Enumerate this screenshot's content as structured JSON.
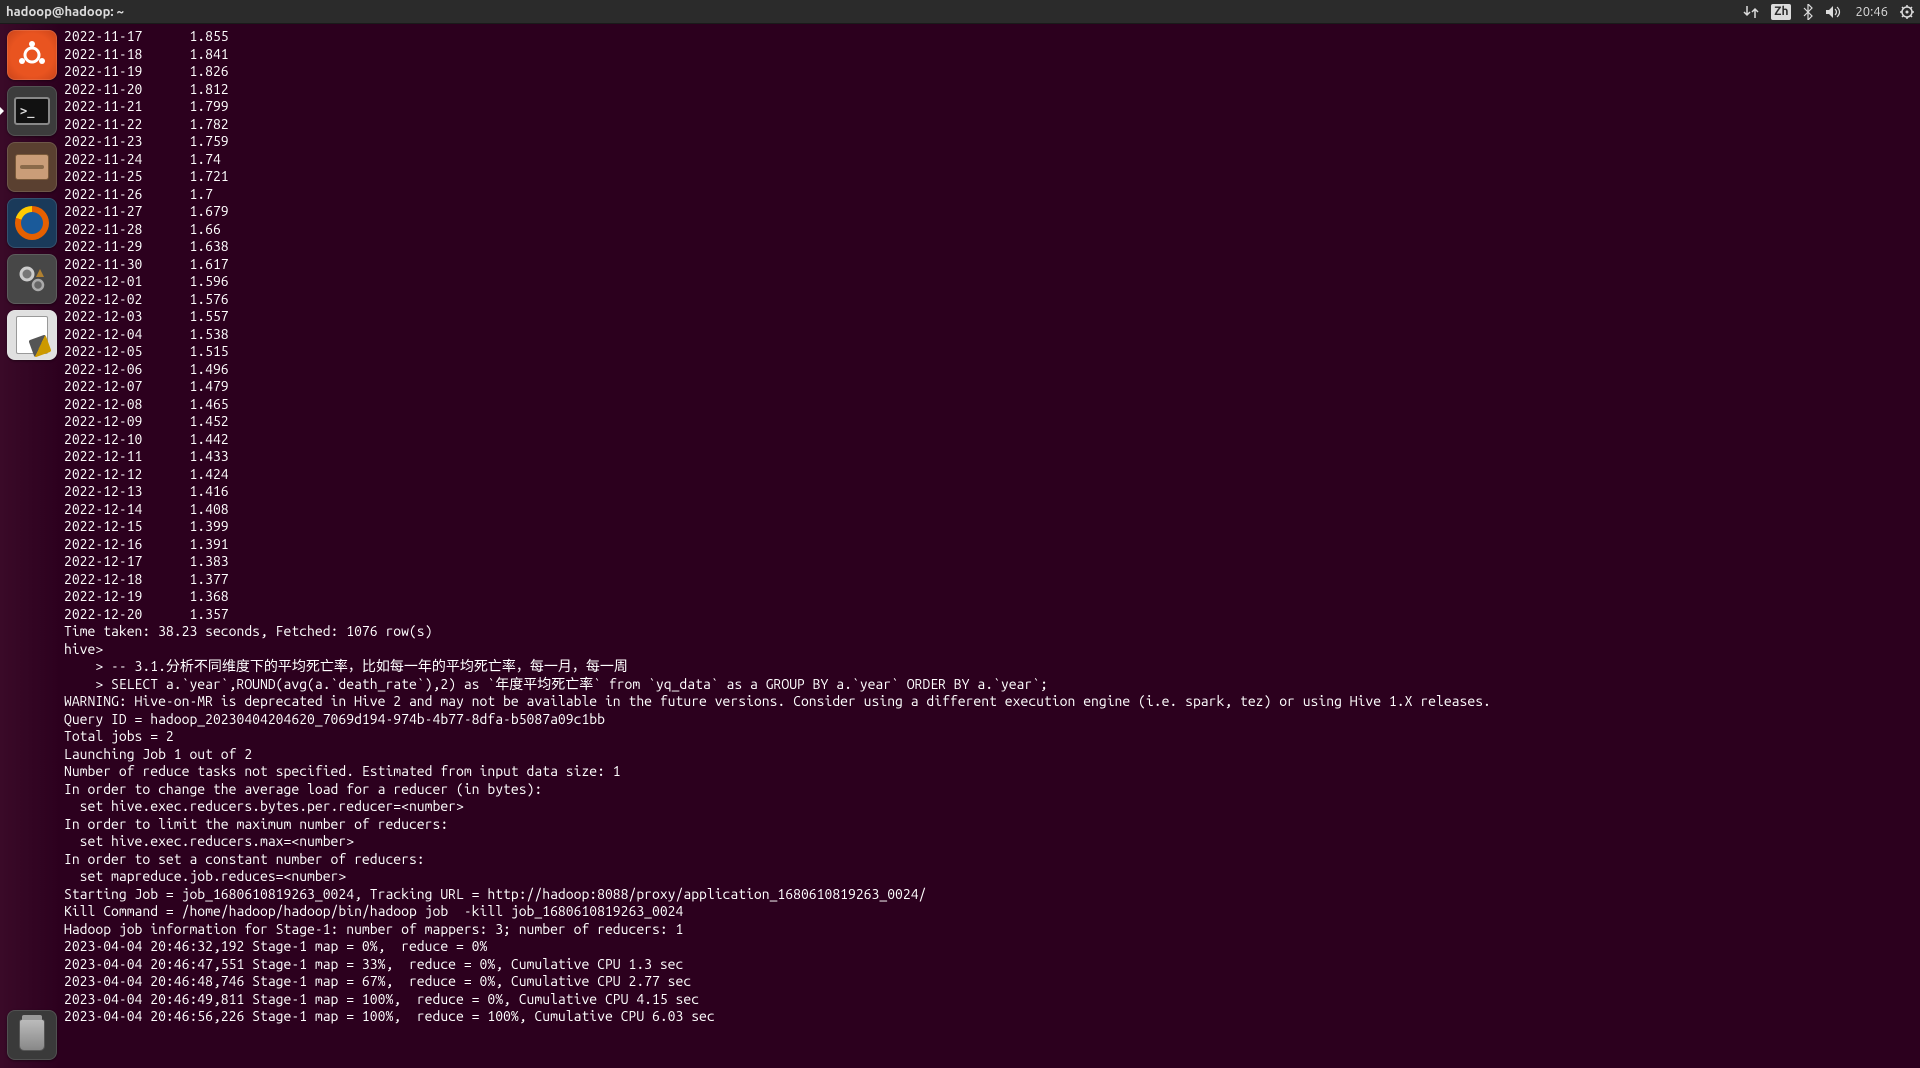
{
  "top_panel": {
    "title": "hadoop@hadoop: ~",
    "input_method": "Zh",
    "time": "20:46"
  },
  "launcher": {
    "items": [
      {
        "name": "ubuntu-dash",
        "label": "Ubuntu"
      },
      {
        "name": "terminal",
        "label": "Terminal",
        "active": true
      },
      {
        "name": "files",
        "label": "Files"
      },
      {
        "name": "firefox",
        "label": "Firefox"
      },
      {
        "name": "settings",
        "label": "Settings"
      },
      {
        "name": "text-editor",
        "label": "Text Editor"
      }
    ],
    "trash": "Trash"
  },
  "terminal": {
    "data_rows": [
      {
        "date": "2022-11-17",
        "val": "1.855"
      },
      {
        "date": "2022-11-18",
        "val": "1.841"
      },
      {
        "date": "2022-11-19",
        "val": "1.826"
      },
      {
        "date": "2022-11-20",
        "val": "1.812"
      },
      {
        "date": "2022-11-21",
        "val": "1.799"
      },
      {
        "date": "2022-11-22",
        "val": "1.782"
      },
      {
        "date": "2022-11-23",
        "val": "1.759"
      },
      {
        "date": "2022-11-24",
        "val": "1.74"
      },
      {
        "date": "2022-11-25",
        "val": "1.721"
      },
      {
        "date": "2022-11-26",
        "val": "1.7"
      },
      {
        "date": "2022-11-27",
        "val": "1.679"
      },
      {
        "date": "2022-11-28",
        "val": "1.66"
      },
      {
        "date": "2022-11-29",
        "val": "1.638"
      },
      {
        "date": "2022-11-30",
        "val": "1.617"
      },
      {
        "date": "2022-12-01",
        "val": "1.596"
      },
      {
        "date": "2022-12-02",
        "val": "1.576"
      },
      {
        "date": "2022-12-03",
        "val": "1.557"
      },
      {
        "date": "2022-12-04",
        "val": "1.538"
      },
      {
        "date": "2022-12-05",
        "val": "1.515"
      },
      {
        "date": "2022-12-06",
        "val": "1.496"
      },
      {
        "date": "2022-12-07",
        "val": "1.479"
      },
      {
        "date": "2022-12-08",
        "val": "1.465"
      },
      {
        "date": "2022-12-09",
        "val": "1.452"
      },
      {
        "date": "2022-12-10",
        "val": "1.442"
      },
      {
        "date": "2022-12-11",
        "val": "1.433"
      },
      {
        "date": "2022-12-12",
        "val": "1.424"
      },
      {
        "date": "2022-12-13",
        "val": "1.416"
      },
      {
        "date": "2022-12-14",
        "val": "1.408"
      },
      {
        "date": "2022-12-15",
        "val": "1.399"
      },
      {
        "date": "2022-12-16",
        "val": "1.391"
      },
      {
        "date": "2022-12-17",
        "val": "1.383"
      },
      {
        "date": "2022-12-18",
        "val": "1.377"
      },
      {
        "date": "2022-12-19",
        "val": "1.368"
      },
      {
        "date": "2022-12-20",
        "val": "1.357"
      }
    ],
    "footer_lines": [
      "Time taken: 38.23 seconds, Fetched: 1076 row(s)",
      "hive>",
      "    > -- 3.1.分析不同维度下的平均死亡率，比如每一年的平均死亡率，每一月，每一周",
      "    > SELECT a.`year`,ROUND(avg(a.`death_rate`),2) as `年度平均死亡率` from `yq_data` as a GROUP BY a.`year` ORDER BY a.`year`;",
      "WARNING: Hive-on-MR is deprecated in Hive 2 and may not be available in the future versions. Consider using a different execution engine (i.e. spark, tez) or using Hive 1.X releases.",
      "Query ID = hadoop_20230404204620_7069d194-974b-4b77-8dfa-b5087a09c1bb",
      "Total jobs = 2",
      "Launching Job 1 out of 2",
      "Number of reduce tasks not specified. Estimated from input data size: 1",
      "In order to change the average load for a reducer (in bytes):",
      "  set hive.exec.reducers.bytes.per.reducer=<number>",
      "In order to limit the maximum number of reducers:",
      "  set hive.exec.reducers.max=<number>",
      "In order to set a constant number of reducers:",
      "  set mapreduce.job.reduces=<number>",
      "Starting Job = job_1680610819263_0024, Tracking URL = http://hadoop:8088/proxy/application_1680610819263_0024/",
      "Kill Command = /home/hadoop/hadoop/bin/hadoop job  -kill job_1680610819263_0024",
      "Hadoop job information for Stage-1: number of mappers: 3; number of reducers: 1",
      "2023-04-04 20:46:32,192 Stage-1 map = 0%,  reduce = 0%",
      "2023-04-04 20:46:47,551 Stage-1 map = 33%,  reduce = 0%, Cumulative CPU 1.3 sec",
      "2023-04-04 20:46:48,746 Stage-1 map = 67%,  reduce = 0%, Cumulative CPU 2.77 sec",
      "2023-04-04 20:46:49,811 Stage-1 map = 100%,  reduce = 0%, Cumulative CPU 4.15 sec",
      "2023-04-04 20:46:56,226 Stage-1 map = 100%,  reduce = 100%, Cumulative CPU 6.03 sec"
    ]
  }
}
